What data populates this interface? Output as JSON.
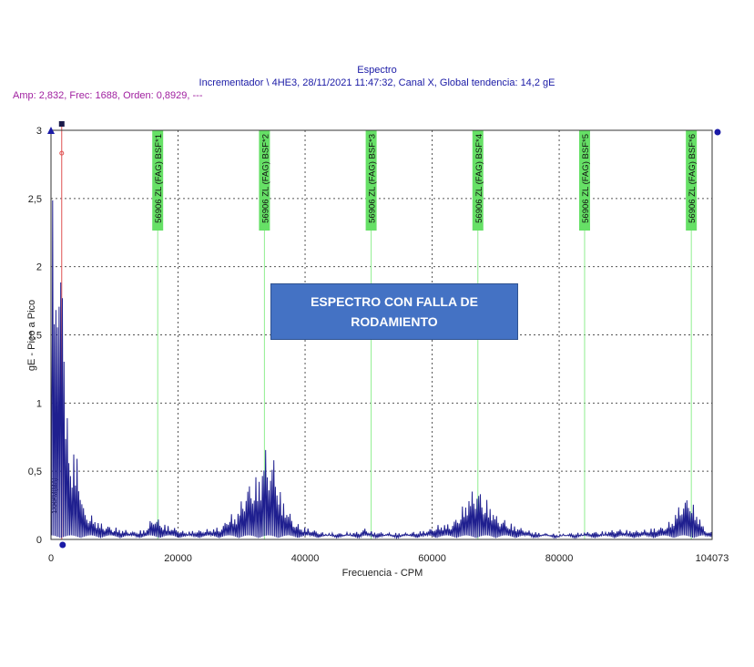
{
  "header": {
    "title": "Espectro",
    "subtitle": "Incrementador \\ 4HE3, 28/11/2021 11:47:32, Canal X, Global tendencia: 14,2 gE",
    "cursor_readout": "Amp: 2,832, Frec: 1688, Orden: 0,8929, ---"
  },
  "annotation": {
    "text": "ESPECTRO CON FALLA DE RODAMIENTO"
  },
  "colors": {
    "spectrum": "#1f1f8f",
    "grid": "#555555",
    "marker_line": "#90ee90",
    "marker_label_bg": "#66e066",
    "cursor_line": "#e05050",
    "banner_bg": "#4472c4"
  },
  "chart_data": {
    "type": "line",
    "xlabel": "Frecuencia - CPM",
    "ylabel": "gE - Pico a Pico",
    "xlim": [
      0,
      104073
    ],
    "ylim": [
      0,
      3
    ],
    "x_ticks": [
      0,
      20000,
      40000,
      60000,
      80000,
      104073
    ],
    "x_tick_labels": [
      "0",
      "20000",
      "40000",
      "60000",
      "80000",
      "104073"
    ],
    "y_ticks": [
      0,
      0.5,
      1,
      1.5,
      2,
      2.5,
      3
    ],
    "y_tick_labels": [
      "0",
      "0,5",
      "1",
      "1,5",
      "2",
      "2,5",
      "3"
    ],
    "grid": true,
    "cursor": {
      "x": 1688,
      "y": 2.832,
      "label": "1XRPM(MA)"
    },
    "markers": [
      {
        "x": 16800,
        "label": "56906 ZL (FAG) BSF*1"
      },
      {
        "x": 33600,
        "label": "56906 ZL (FAG) BSF*2"
      },
      {
        "x": 50400,
        "label": "56906 ZL (FAG) BSF*3"
      },
      {
        "x": 67200,
        "label": "56906 ZL (FAG) BSF*4"
      },
      {
        "x": 84000,
        "label": "56906 ZL (FAG) BSF*5"
      },
      {
        "x": 100800,
        "label": "56906 ZL (FAG) BSF*6"
      }
    ],
    "series": [
      {
        "peaks": [
          [
            500,
            2.72
          ],
          [
            900,
            2.4
          ],
          [
            1300,
            1.8
          ],
          [
            1700,
            2.83
          ],
          [
            2000,
            2.25
          ],
          [
            2300,
            1.0
          ],
          [
            2700,
            0.9
          ],
          [
            3100,
            0.62
          ],
          [
            3500,
            0.72
          ],
          [
            4300,
            0.6
          ],
          [
            5200,
            0.22
          ],
          [
            6000,
            0.2
          ],
          [
            7000,
            0.16
          ],
          [
            8000,
            0.12
          ],
          [
            9500,
            0.1
          ],
          [
            11000,
            0.08
          ],
          [
            13000,
            0.06
          ],
          [
            15000,
            0.08
          ],
          [
            16000,
            0.18
          ],
          [
            16800,
            0.16
          ],
          [
            17700,
            0.12
          ],
          [
            19000,
            0.1
          ],
          [
            21000,
            0.06
          ],
          [
            23000,
            0.07
          ],
          [
            25000,
            0.08
          ],
          [
            27000,
            0.1
          ],
          [
            28000,
            0.2
          ],
          [
            29000,
            0.18
          ],
          [
            30000,
            0.3
          ],
          [
            30900,
            0.42
          ],
          [
            31600,
            0.44
          ],
          [
            32300,
            0.48
          ],
          [
            33000,
            0.5
          ],
          [
            33600,
            0.75
          ],
          [
            34200,
            0.58
          ],
          [
            34900,
            0.66
          ],
          [
            35600,
            0.5
          ],
          [
            36300,
            0.32
          ],
          [
            37200,
            0.25
          ],
          [
            38200,
            0.14
          ],
          [
            39500,
            0.1
          ],
          [
            41000,
            0.08
          ],
          [
            43000,
            0.05
          ],
          [
            46000,
            0.05
          ],
          [
            48500,
            0.06
          ],
          [
            49500,
            0.09
          ],
          [
            50500,
            0.06
          ],
          [
            53000,
            0.05
          ],
          [
            56000,
            0.05
          ],
          [
            59000,
            0.07
          ],
          [
            61500,
            0.12
          ],
          [
            63000,
            0.12
          ],
          [
            64300,
            0.2
          ],
          [
            65300,
            0.3
          ],
          [
            66200,
            0.37
          ],
          [
            67000,
            0.41
          ],
          [
            67800,
            0.35
          ],
          [
            68600,
            0.3
          ],
          [
            69400,
            0.25
          ],
          [
            70300,
            0.17
          ],
          [
            71500,
            0.15
          ],
          [
            72500,
            0.12
          ],
          [
            73500,
            0.1
          ],
          [
            75000,
            0.07
          ],
          [
            77000,
            0.05
          ],
          [
            80000,
            0.04
          ],
          [
            83000,
            0.05
          ],
          [
            85000,
            0.06
          ],
          [
            87000,
            0.06
          ],
          [
            89000,
            0.08
          ],
          [
            91000,
            0.07
          ],
          [
            93000,
            0.07
          ],
          [
            95000,
            0.09
          ],
          [
            96500,
            0.1
          ],
          [
            97500,
            0.14
          ],
          [
            98300,
            0.2
          ],
          [
            99000,
            0.28
          ],
          [
            99700,
            0.3
          ],
          [
            100400,
            0.36
          ],
          [
            101100,
            0.26
          ],
          [
            101900,
            0.2
          ],
          [
            102700,
            0.1
          ],
          [
            103500,
            0.06
          ]
        ]
      }
    ]
  }
}
